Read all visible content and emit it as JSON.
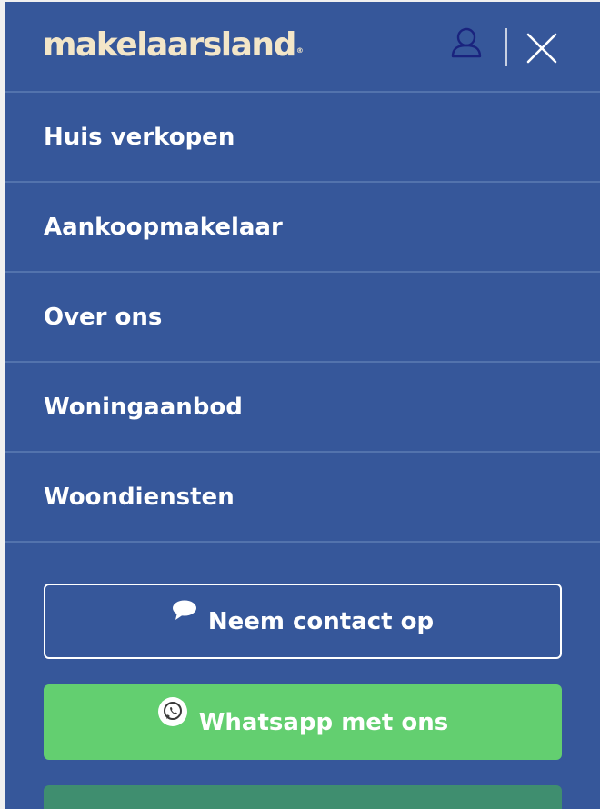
{
  "header": {
    "logo_text": "makelaarsland",
    "logo_mark": "®",
    "user_icon": "user-icon",
    "close_icon": "close-icon"
  },
  "menu": {
    "items": [
      {
        "label": "Huis verkopen"
      },
      {
        "label": "Aankoopmakelaar"
      },
      {
        "label": "Over ons"
      },
      {
        "label": "Woningaanbod"
      },
      {
        "label": "Woondiensten"
      }
    ]
  },
  "actions": {
    "contact_label": "Neem contact op",
    "contact_icon": "speech-bubble-icon",
    "whatsapp_label": "Whatsapp met ons",
    "whatsapp_icon": "whatsapp-icon"
  },
  "colors": {
    "panel_bg": "#36579a",
    "logo": "#f3e6c8",
    "whatsapp_green": "#63cf70",
    "user_icon": "#1a237e"
  }
}
